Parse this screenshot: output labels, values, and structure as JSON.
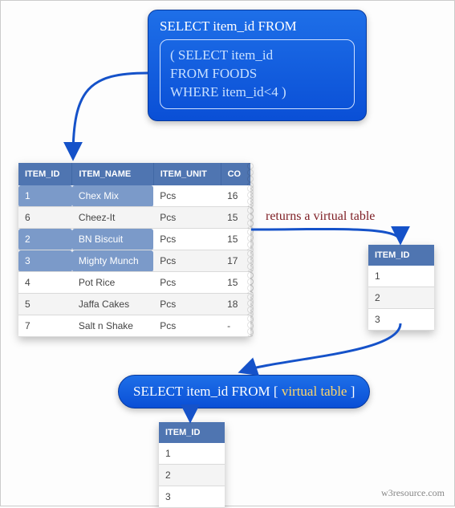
{
  "sql_outer": "SELECT item_id FROM",
  "sql_inner": {
    "l1": "( SELECT item_id",
    "l2": "FROM FOODS",
    "l3": "WHERE item_id<4 )"
  },
  "main_table": {
    "headers": [
      "ITEM_ID",
      "ITEM_NAME",
      "ITEM_UNIT",
      "CO"
    ],
    "rows": [
      {
        "cells": [
          "1",
          "Chex Mix",
          "Pcs",
          "16"
        ],
        "highlight": true
      },
      {
        "cells": [
          "6",
          "Cheez-It",
          "Pcs",
          "15"
        ],
        "highlight": false
      },
      {
        "cells": [
          "2",
          "BN Biscuit",
          "Pcs",
          "15"
        ],
        "highlight": true
      },
      {
        "cells": [
          "3",
          "Mighty Munch",
          "Pcs",
          "17"
        ],
        "highlight": true
      },
      {
        "cells": [
          "4",
          "Pot Rice",
          "Pcs",
          "15"
        ],
        "highlight": false
      },
      {
        "cells": [
          "5",
          "Jaffa Cakes",
          "Pcs",
          "18"
        ],
        "highlight": false
      },
      {
        "cells": [
          "7",
          "Salt n Shake",
          "Pcs",
          "-"
        ],
        "highlight": false
      }
    ]
  },
  "virtual_table": {
    "header": "ITEM_ID",
    "rows": [
      "1",
      "2",
      "3"
    ]
  },
  "annotation": "returns a virtual table",
  "pill": {
    "prefix": "SELECT item_id FROM [ ",
    "highlight": "virtual table",
    "suffix": " ]"
  },
  "attribution": "w3resource.com",
  "chart_data": {
    "type": "table",
    "title": "SQL subquery diagram: SELECT item_id FROM (SELECT item_id FROM FOODS WHERE item_id<4)",
    "foods_table": {
      "columns": [
        "ITEM_ID",
        "ITEM_NAME",
        "ITEM_UNIT",
        "COMPANY_ID_partial"
      ],
      "rows": [
        [
          1,
          "Chex Mix",
          "Pcs",
          16
        ],
        [
          6,
          "Cheez-It",
          "Pcs",
          15
        ],
        [
          2,
          "BN Biscuit",
          "Pcs",
          15
        ],
        [
          3,
          "Mighty Munch",
          "Pcs",
          17
        ],
        [
          4,
          "Pot Rice",
          "Pcs",
          15
        ],
        [
          5,
          "Jaffa Cakes",
          "Pcs",
          18
        ],
        [
          7,
          "Salt n Shake",
          "Pcs",
          null
        ]
      ]
    },
    "subquery_result": {
      "columns": [
        "ITEM_ID"
      ],
      "rows": [
        [
          1
        ],
        [
          2
        ],
        [
          3
        ]
      ]
    },
    "outer_result": {
      "columns": [
        "ITEM_ID"
      ],
      "rows": [
        [
          1
        ],
        [
          2
        ],
        [
          3
        ]
      ]
    }
  }
}
